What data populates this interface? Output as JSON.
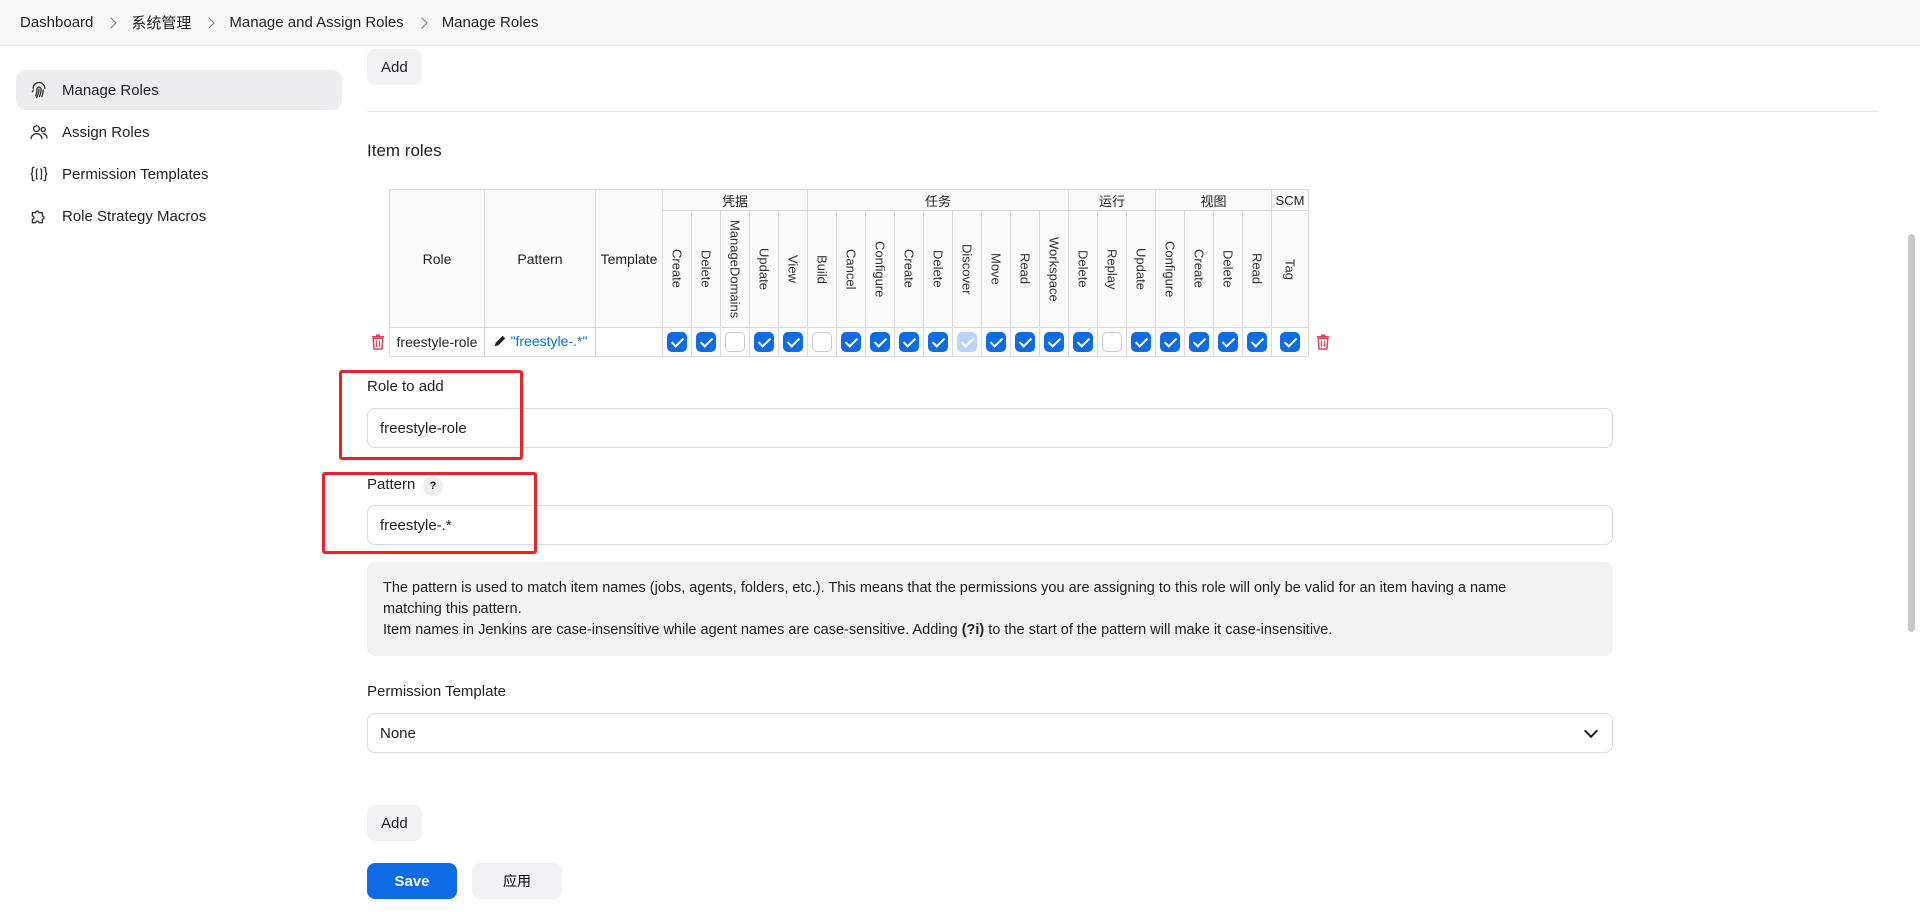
{
  "breadcrumb": [
    "Dashboard",
    "系统管理",
    "Manage and Assign Roles",
    "Manage Roles"
  ],
  "sidebar": {
    "items": [
      {
        "label": "Manage Roles",
        "icon": "fingerprint-icon",
        "active": true
      },
      {
        "label": "Assign Roles",
        "icon": "users-icon",
        "active": false
      },
      {
        "label": "Permission Templates",
        "icon": "braces-icon",
        "active": false
      },
      {
        "label": "Role Strategy Macros",
        "icon": "puzzle-icon",
        "active": false
      }
    ]
  },
  "top_add_label": "Add",
  "item_roles": {
    "title": "Item roles",
    "headers": {
      "role": "Role",
      "pattern": "Pattern",
      "template": "Template"
    },
    "groups": [
      {
        "label": "凭据",
        "perms": [
          "Create",
          "Delete",
          "ManageDomains",
          "Update",
          "View"
        ]
      },
      {
        "label": "任务",
        "perms": [
          "Build",
          "Cancel",
          "Configure",
          "Create",
          "Delete",
          "Discover",
          "Move",
          "Read",
          "Workspace"
        ]
      },
      {
        "label": "运行",
        "perms": [
          "Delete",
          "Replay",
          "Update"
        ]
      },
      {
        "label": "视图",
        "perms": [
          "Configure",
          "Create",
          "Delete",
          "Read"
        ]
      },
      {
        "label": "SCM",
        "perms": [
          "Tag"
        ]
      }
    ],
    "rows": [
      {
        "role": "freestyle-role",
        "pattern": "\"freestyle-.*\"",
        "template": "",
        "checks": [
          "on",
          "on",
          "off",
          "on",
          "on",
          "off",
          "on",
          "on",
          "on",
          "on",
          "dim",
          "on",
          "on",
          "on",
          "on",
          "off",
          "on",
          "on",
          "on",
          "on",
          "on",
          "on"
        ]
      }
    ]
  },
  "form": {
    "role_label": "Role to add",
    "role_value": "freestyle-role",
    "pattern_label": "Pattern",
    "pattern_help": "?",
    "pattern_value": "freestyle-.*",
    "help_line1": "The pattern is used to match item names (jobs, agents, folders, etc.). This means that the permissions you are assigning to this role will only be valid for an item having a name",
    "help_line2": "matching this pattern.",
    "help_line3_pre": "Item names in Jenkins are case-insensitive while agent names are case-sensitive. Adding ",
    "help_line3_code": "(?i)",
    "help_line3_post": " to the start of the pattern will make it case-insensitive.",
    "template_label": "Permission Template",
    "template_value": "None",
    "add_label": "Add"
  },
  "footer": {
    "save_label": "Save",
    "apply_label": "应用"
  },
  "colors": {
    "accent": "#0d6be3",
    "highlight": "#e8232a",
    "danger": "#e0405a"
  }
}
